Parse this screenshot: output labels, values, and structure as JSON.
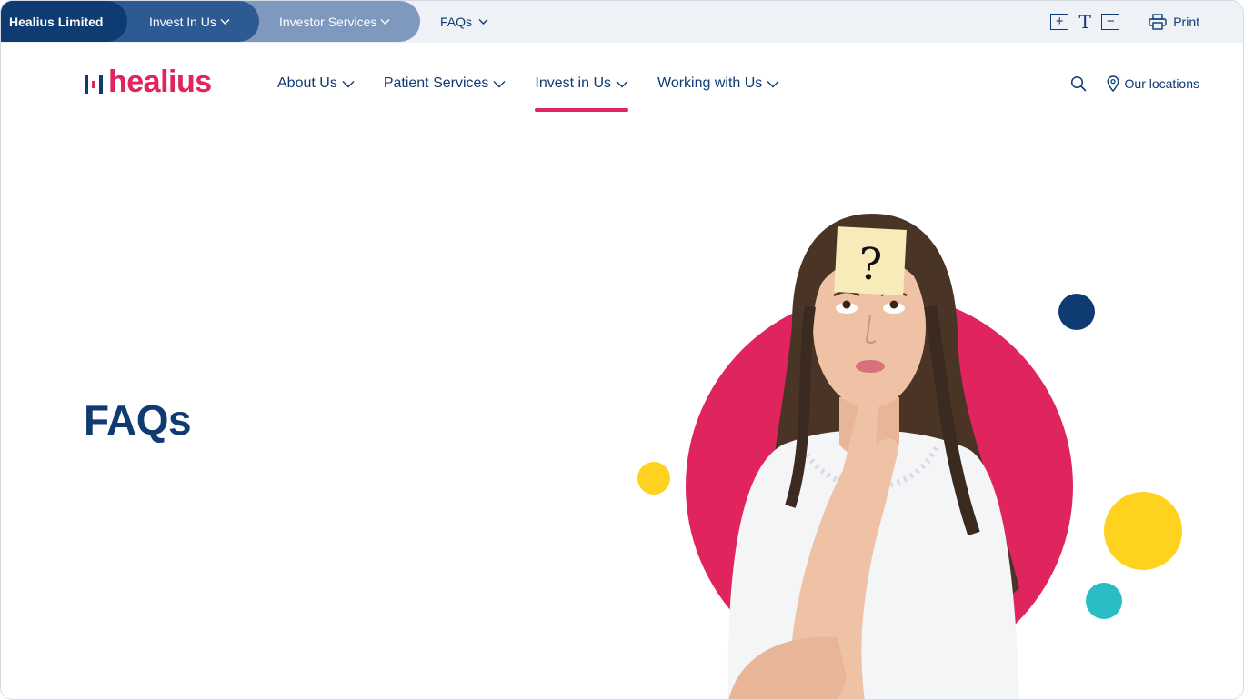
{
  "utility_bar": {
    "crumbs": [
      "Healius Limited",
      "Invest In Us",
      "Investor Services"
    ],
    "faqs_label": "FAQs",
    "tools": {
      "increase": "+",
      "text": "T",
      "decrease": "−"
    },
    "print_label": "Print"
  },
  "brand": {
    "logo_text": "healius",
    "primary": "#0f3b73",
    "accent": "#e0245e"
  },
  "nav": {
    "items": [
      "About Us",
      "Patient Services",
      "Invest in Us",
      "Working with Us"
    ],
    "active": "Invest in Us",
    "locations_label": "Our locations"
  },
  "hero": {
    "title": "FAQs",
    "note_symbol": "?",
    "circle_colors": [
      "#e0245e",
      "#0f3b73",
      "#ffd21f",
      "#2bbdc4"
    ]
  }
}
